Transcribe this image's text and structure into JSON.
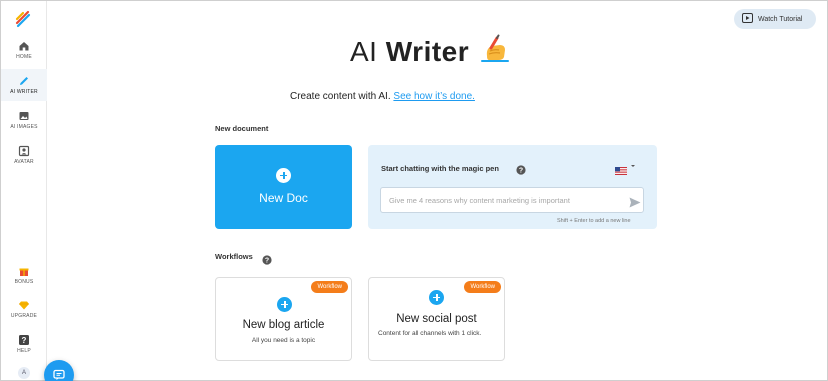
{
  "sidebar": {
    "logo": "writer-logo-icon",
    "items": [
      {
        "label": "HOME",
        "icon": "home-icon"
      },
      {
        "label": "AI WRITER",
        "icon": "pen-icon",
        "active": true
      },
      {
        "label": "AI IMAGES",
        "icon": "image-icon"
      },
      {
        "label": "AVATAR",
        "icon": "avatar-icon"
      },
      {
        "label": "BONUS",
        "icon": "gift-icon"
      },
      {
        "label": "UPGRADE",
        "icon": "diamond-icon"
      },
      {
        "label": "HELP",
        "icon": "help-icon"
      }
    ],
    "avatar_initial": "A"
  },
  "header": {
    "watch_tutorial": "Watch Tutorial",
    "title_light": "AI",
    "title_bold": "Writer",
    "title_icon": "writing-hand-icon",
    "subtitle": "Create content with AI.",
    "subtitle_link": "See how it’s done."
  },
  "new_document": {
    "section_label": "New document",
    "new_doc_label": "New Doc",
    "magic_pen": {
      "heading": "Start chatting with the magic pen",
      "placeholder": "Give me 4 reasons why content marketing is important",
      "hint": "Shift + Enter to add a new line",
      "language_flag": "us-flag-icon"
    }
  },
  "workflows": {
    "section_label": "Workflows",
    "cards": [
      {
        "badge": "Workflow",
        "title": "New blog article",
        "description": "All you need is a topic"
      },
      {
        "badge": "Workflow",
        "title": "New social post",
        "description": "Content for all channels with 1 click."
      }
    ]
  },
  "colors": {
    "accent": "#1ba6f0",
    "badge": "#f47d1a",
    "magic_bg": "#e3f1fb"
  }
}
